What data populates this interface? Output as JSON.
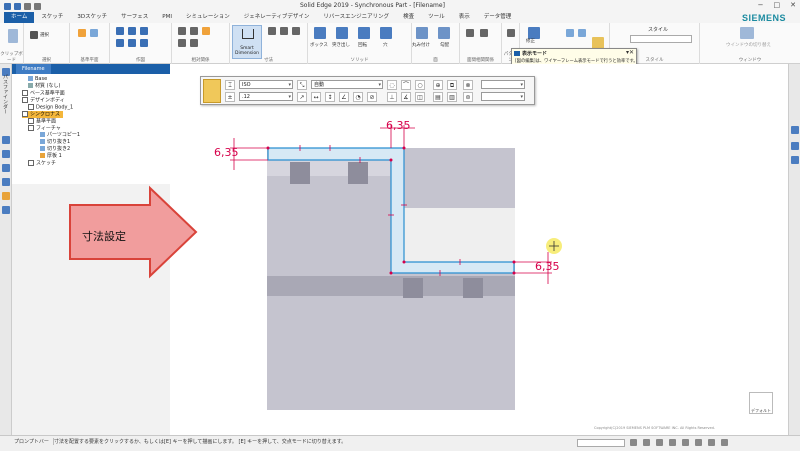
{
  "window": {
    "title": "Solid Edge 2019 - Synchronous Part - [Filename]",
    "controls": [
      "−",
      "□",
      "✕"
    ]
  },
  "brand": "SIEMENS",
  "ribbon_tabs": [
    "ホーム",
    "スケッチ",
    "3Dスケッチ",
    "サーフェス",
    "PMI",
    "シミュレーション",
    "ジェネレーティブデザイン",
    "リバースエンジニアリング",
    "検査",
    "ツール",
    "表示",
    "データ管理"
  ],
  "ribbon": {
    "groups": [
      "クリップボード",
      "選択",
      "基準平面",
      "作図",
      "相対関係",
      "寸法",
      "ソリッド",
      "面",
      "面間相関関係",
      "パターン",
      "モデル",
      "スタイル",
      "ウィンドウ"
    ],
    "select_label": "選択",
    "smart_dimension_label": "Smart Dimension",
    "tool_labels": [
      "ボックス",
      "突き出し",
      "回転",
      "穴",
      "丸み付け",
      "勾配",
      "修正"
    ],
    "style_label": "スタイル",
    "window_labels": [
      "ウインドウの切り替え"
    ]
  },
  "tooltip": {
    "title": "表示モード",
    "body": "[図の編集]は、ワイヤーフレーム表示モードで行うと効率です。"
  },
  "pathfinder": {
    "tab": "Filename",
    "items": [
      {
        "label": "Base",
        "level": 1,
        "highlight": false
      },
      {
        "label": "材質 (なし)",
        "level": 1,
        "highlight": false
      },
      {
        "label": "ベース基準平面",
        "level": 1,
        "highlight": false
      },
      {
        "label": "デザインボディ",
        "level": 1,
        "highlight": false
      },
      {
        "label": "Design Body_1",
        "level": 2,
        "highlight": false
      },
      {
        "label": "シンクロナス",
        "level": 1,
        "highlight": true
      },
      {
        "label": "基準平面",
        "level": 2,
        "highlight": false
      },
      {
        "label": "フィーチャ",
        "level": 2,
        "highlight": false
      },
      {
        "label": "パーツコピー1",
        "level": 3,
        "highlight": false
      },
      {
        "label": "切り抜き1",
        "level": 3,
        "highlight": false
      },
      {
        "label": "切り抜き2",
        "level": 3,
        "highlight": false
      },
      {
        "label": "厚板 1",
        "level": 3,
        "highlight": false
      },
      {
        "label": "スケッチ",
        "level": 2,
        "highlight": false
      }
    ]
  },
  "left_vertical_label": "パスファインダー",
  "dimension_bar": {
    "style_value": "ISO",
    "mode_value": "自動",
    "precision_value": ".12"
  },
  "dimensions": {
    "top_width": "6,35",
    "left_thickness": "6,35",
    "right_thickness": "6,35"
  },
  "callout": {
    "text": "寸法設定",
    "fill": "#f19d9d",
    "stroke": "#d9433a"
  },
  "view_button_label": "デフォルトビュー",
  "copyright": "Copyright(C)2019 SIEMENS PLM SOFTWARE INC. All Rights Reserved.",
  "status": {
    "prompt_label": "プロンプトバー",
    "message": "寸法を配置する要素をクリックするか、もしくは[E] キーを押して描画にします。  [E] キーを押して、交点モードに切り替えます。"
  },
  "colors": {
    "accent": "#1b5fa8",
    "dimension": "#d6004a",
    "sketch_fill": "#d7e9f5",
    "body_gray": "#c5c4cf"
  }
}
